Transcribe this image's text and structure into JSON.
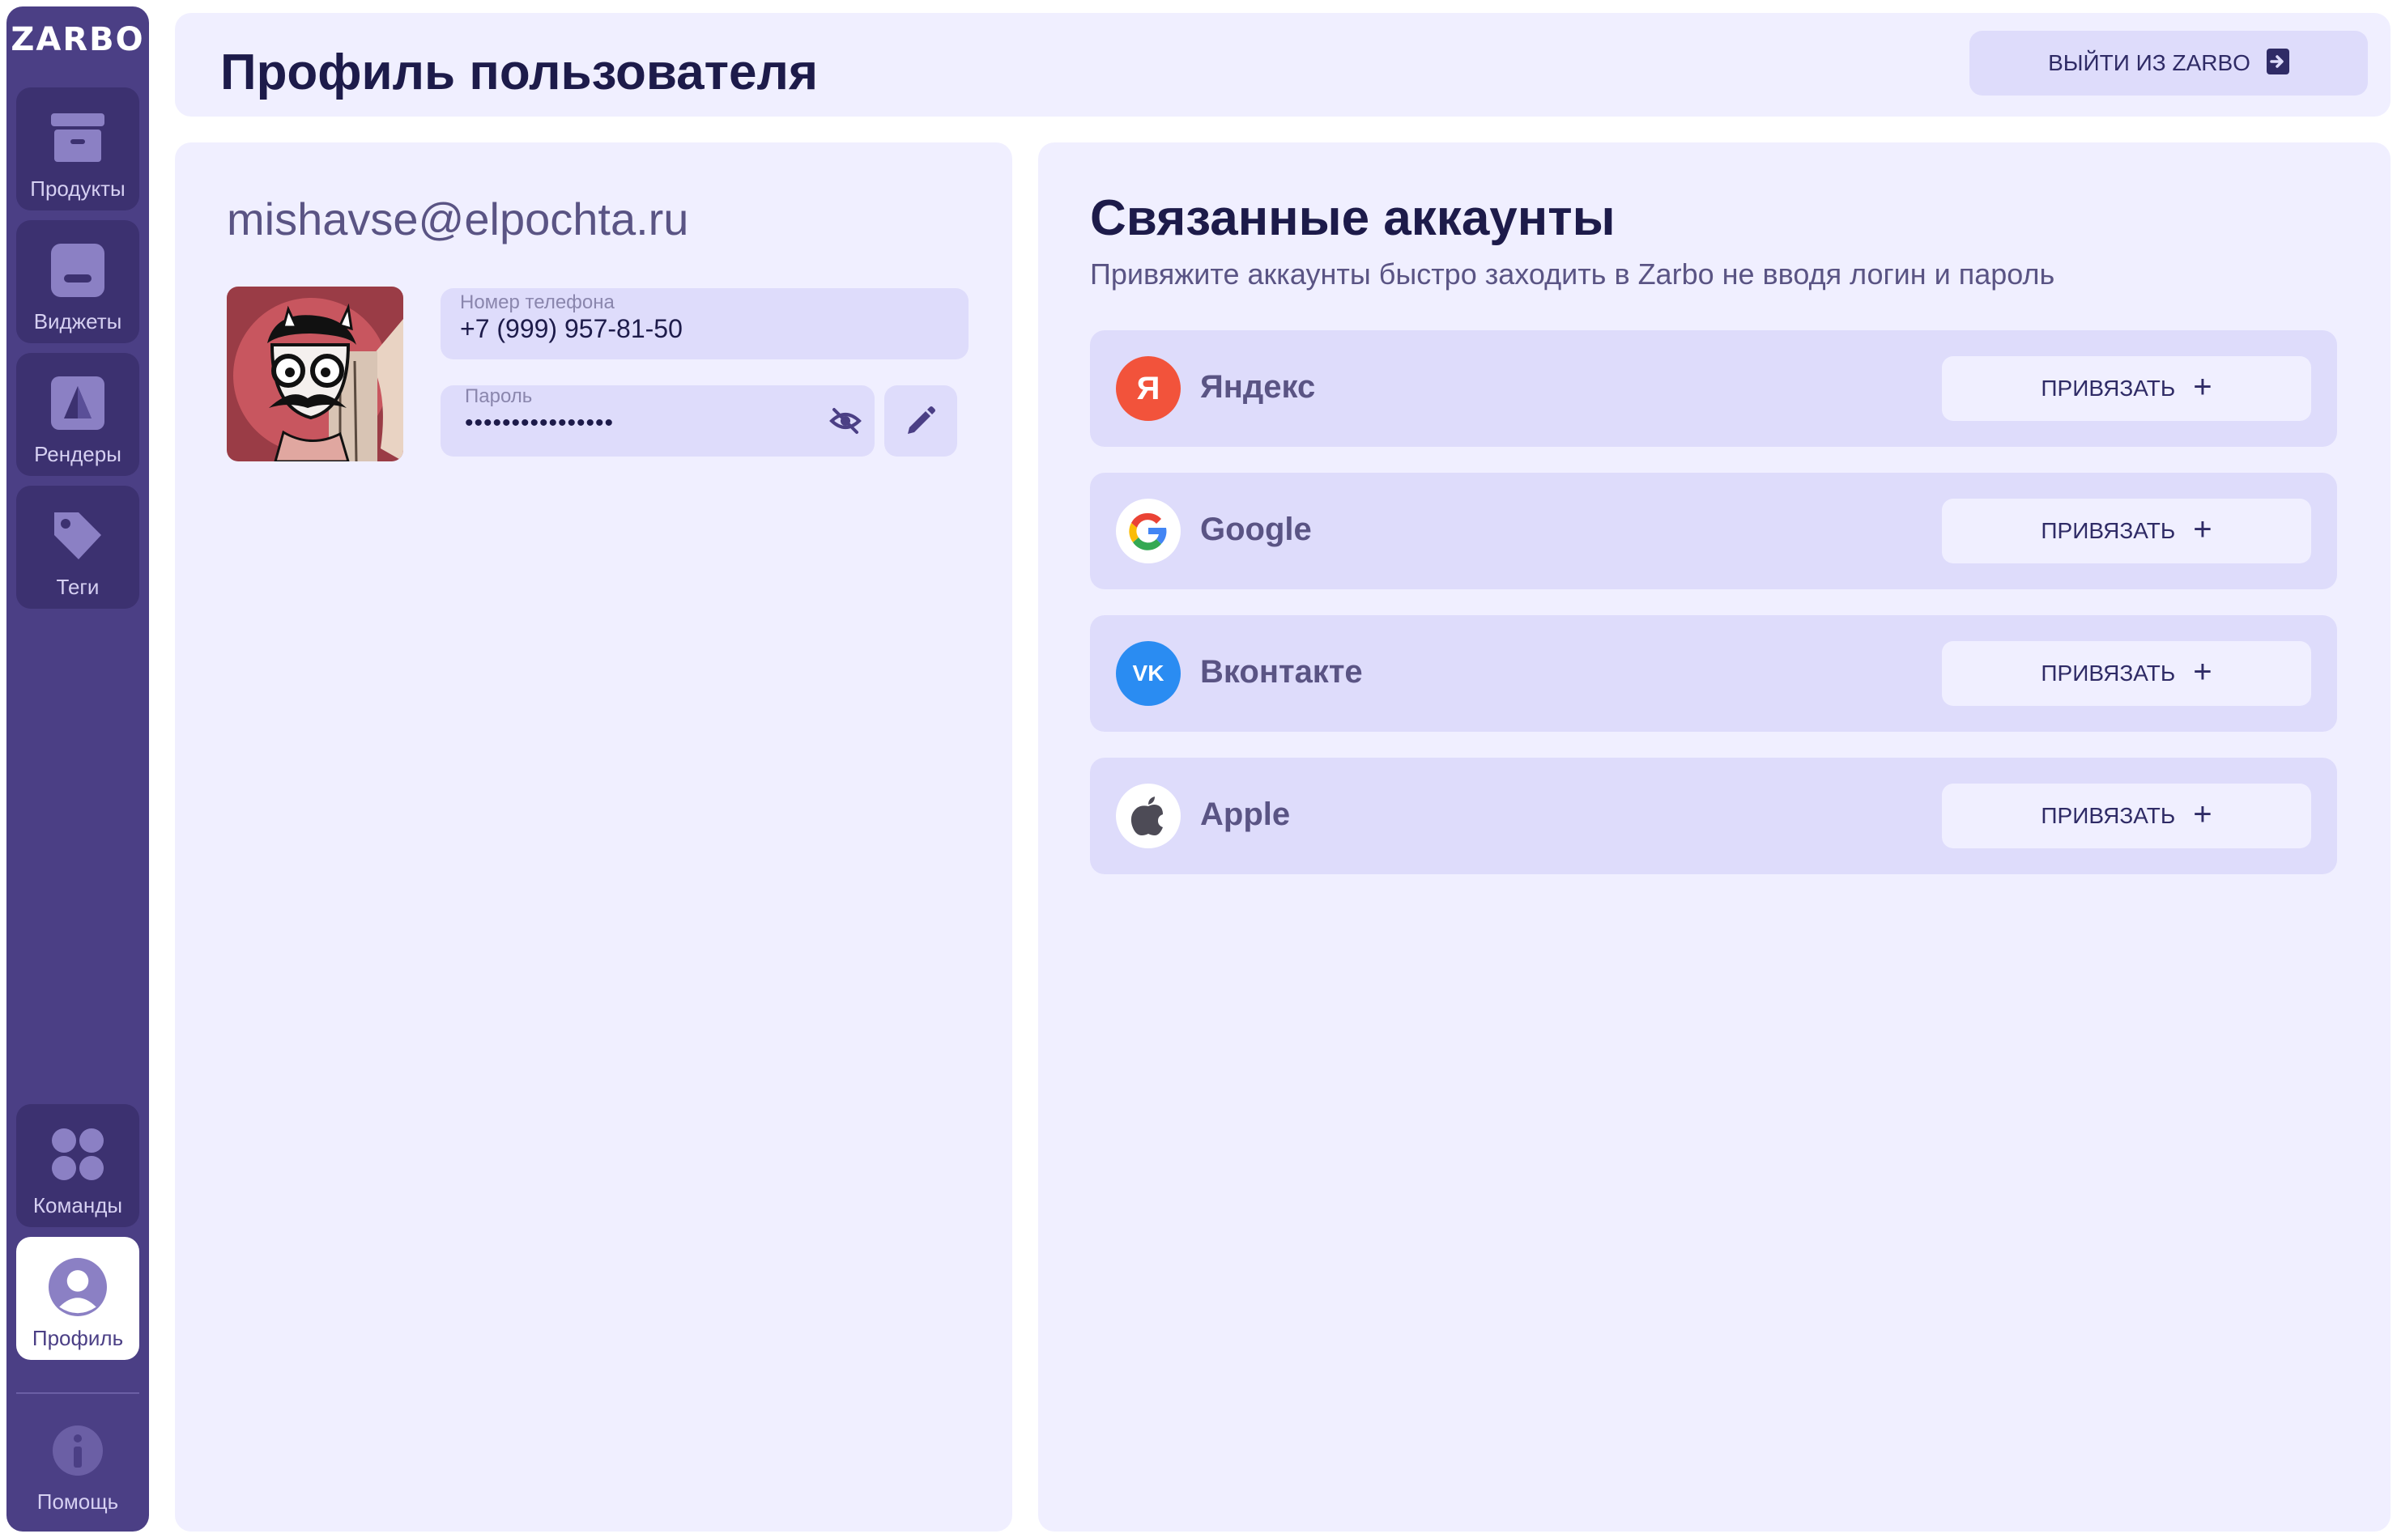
{
  "app": {
    "logo": "ZARBO"
  },
  "sidebar": {
    "items": [
      {
        "label": "Продукты",
        "icon": "archive-box-icon"
      },
      {
        "label": "Виджеты",
        "icon": "widget-icon"
      },
      {
        "label": "Рендеры",
        "icon": "render-pyramid-icon"
      },
      {
        "label": "Теги",
        "icon": "tag-icon"
      }
    ],
    "bottom": [
      {
        "label": "Команды",
        "icon": "teams-grid-icon"
      },
      {
        "label": "Профиль",
        "icon": "user-avatar-icon",
        "active": true
      },
      {
        "label": "Помощь",
        "icon": "info-icon"
      }
    ]
  },
  "header": {
    "title": "Профиль пользователя",
    "logout_label": "ВЫЙТИ ИЗ ZARBO"
  },
  "profile": {
    "email": "mishavse@elpochta.ru",
    "phone_label": "Номер телефона",
    "phone_value": "+7 (999) 957-81-50",
    "password_label": "Пароль",
    "password_value": "••••••••••••••••"
  },
  "linked": {
    "title": "Связанные аккаунты",
    "subtitle": "Привяжите аккаунты быстро заходить в Zarbo не вводя логин и пароль",
    "accounts": [
      {
        "name": "Яндекс",
        "button": "ПРИВЯЗАТЬ",
        "icon": "yandex-icon",
        "glyph": "Я"
      },
      {
        "name": "Google",
        "button": "ПРИВЯЗАТЬ",
        "icon": "google-icon"
      },
      {
        "name": "Вконтакте",
        "button": "ПРИВЯЗАТЬ",
        "icon": "vk-icon",
        "glyph": "VK"
      },
      {
        "name": "Apple",
        "button": "ПРИВЯЗАТЬ",
        "icon": "apple-icon"
      }
    ]
  },
  "colors": {
    "sidebar": "#4b3f85",
    "panel": "#f0efff",
    "accent_light": "#dedcfb",
    "title": "#1d1b4a",
    "yandex": "#f2533b",
    "vk": "#2a8cf2"
  }
}
